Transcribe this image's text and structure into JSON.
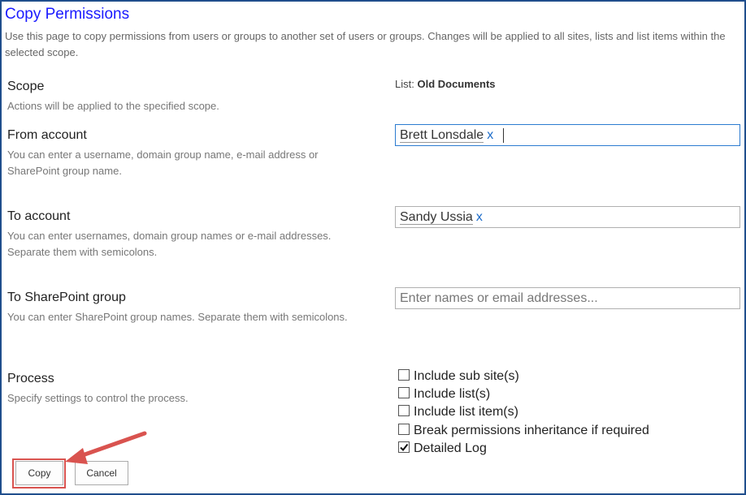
{
  "page": {
    "title": "Copy Permissions",
    "intro": "Use this page to copy permissions from users or groups to another set of users or groups. Changes will be applied to all sites, lists and list items within the selected scope."
  },
  "scope": {
    "label": "Scope",
    "desc": "Actions will be applied to the specified scope.",
    "value_prefix": "List:",
    "value": "Old Documents"
  },
  "from_account": {
    "label": "From account",
    "desc": "You can enter a username, domain group name, e-mail address or SharePoint group name.",
    "entity": "Brett Lonsdale",
    "remove": "x"
  },
  "to_account": {
    "label": "To account",
    "desc": "You can enter usernames, domain group names or e-mail addresses. Separate them with semicolons.",
    "entity": "Sandy Ussia",
    "remove": "x"
  },
  "to_group": {
    "label": "To SharePoint group",
    "desc": "You can enter SharePoint group names. Separate them with semicolons.",
    "placeholder": "Enter names or email addresses..."
  },
  "process": {
    "label": "Process",
    "desc": "Specify settings to control the process.",
    "options": [
      {
        "label": "Include sub site(s)",
        "checked": false
      },
      {
        "label": "Include list(s)",
        "checked": false
      },
      {
        "label": "Include list item(s)",
        "checked": false
      },
      {
        "label": "Break permissions inheritance if required",
        "checked": false
      },
      {
        "label": "Detailed Log",
        "checked": true
      }
    ]
  },
  "buttons": {
    "copy": "Copy",
    "cancel": "Cancel"
  },
  "colors": {
    "title": "#1a1aff",
    "frame": "#1f4e8c",
    "annotation": "#d9534f",
    "link": "#1a6ac9"
  }
}
